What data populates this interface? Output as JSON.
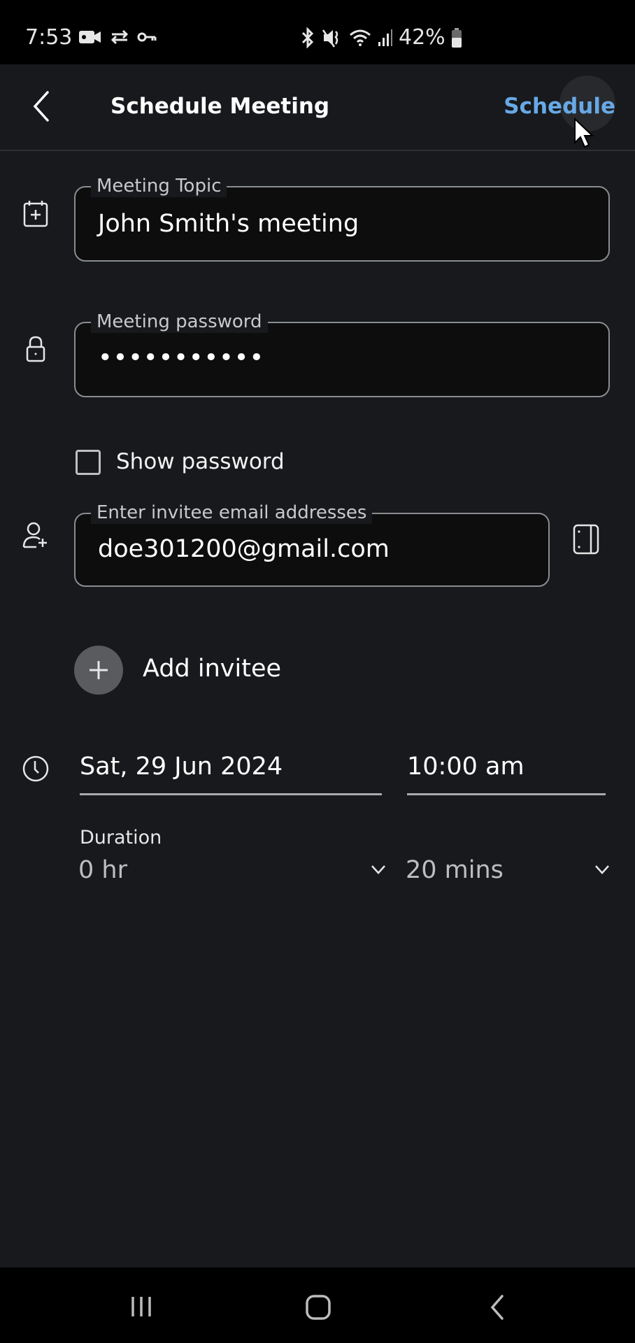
{
  "status_bar": {
    "time": "7:53",
    "left_icons": [
      "video-camera-icon",
      "sync-check-icon",
      "vpn-key-icon"
    ],
    "right_icons": [
      "bluetooth-icon",
      "mute-icon",
      "wifi-icon",
      "signal-icon",
      "battery-icon"
    ],
    "battery_percent": "42%"
  },
  "app_bar": {
    "title": "Schedule Meeting",
    "action_label": "Schedule",
    "accent_color": "#67a9e6"
  },
  "form": {
    "topic": {
      "label": "Meeting Topic",
      "value": "John Smith's meeting",
      "icon": "calendar-add-icon"
    },
    "password": {
      "label": "Meeting password",
      "value": "•••••••••••",
      "icon": "lock-icon"
    },
    "show_password": {
      "label": "Show password",
      "checked": false
    },
    "invitee": {
      "label": "Enter invitee email addresses",
      "value": "doe301200@gmail.com",
      "icon": "person-add-icon",
      "side_icon": "contacts-book-icon"
    },
    "add_invitee": {
      "label": "Add invitee",
      "icon": "plus-icon"
    },
    "date": {
      "value": "Sat, 29 Jun 2024",
      "icon": "clock-icon"
    },
    "time": {
      "value": "10:00 am"
    },
    "duration": {
      "label": "Duration",
      "hours": "0 hr",
      "minutes": "20 mins"
    }
  },
  "nav_bar": {
    "buttons": [
      "recent-apps",
      "home",
      "back"
    ]
  }
}
